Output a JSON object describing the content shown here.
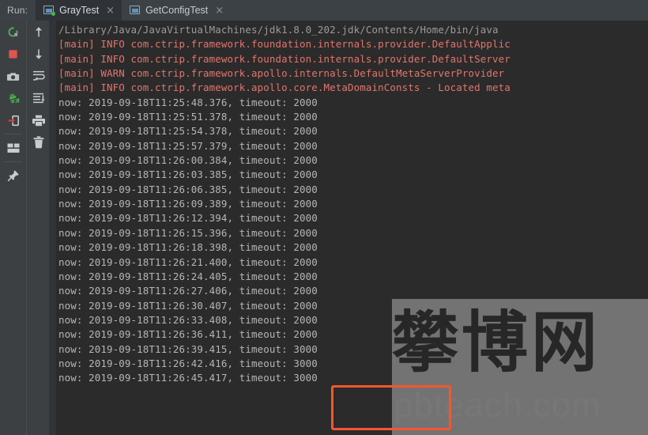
{
  "tabbar": {
    "run_label": "Run:",
    "tabs": [
      {
        "label": "GrayTest",
        "close": "×",
        "active": true,
        "running": true,
        "icon": "run-config-icon"
      },
      {
        "label": "GetConfigTest",
        "close": "×",
        "active": false,
        "running": false,
        "icon": "run-config-icon"
      }
    ]
  },
  "toolbar_left": {
    "items": [
      {
        "name": "rerun-button",
        "icon": "rerun-icon"
      },
      {
        "name": "stop-button",
        "icon": "stop-square-icon"
      },
      {
        "name": "screenshot-button",
        "icon": "camera-icon"
      },
      {
        "name": "rerun-failed-tests-button",
        "icon": "rerun-failed-icon"
      },
      {
        "name": "export-button",
        "icon": "export-arrow-icon"
      },
      {
        "name": "layout-button",
        "icon": "layout-icon"
      },
      {
        "name": "pin-tab-button",
        "icon": "pin-icon"
      }
    ]
  },
  "toolbar_right": {
    "items": [
      {
        "name": "up-stacktrace-button",
        "icon": "arrow-up-icon"
      },
      {
        "name": "down-stacktrace-button",
        "icon": "arrow-down-icon"
      },
      {
        "name": "soft-wrap-button",
        "icon": "soft-wrap-icon"
      },
      {
        "name": "scroll-to-end-button",
        "icon": "scroll-to-end-icon"
      },
      {
        "name": "print-button",
        "icon": "printer-icon"
      },
      {
        "name": "clear-all-button",
        "icon": "trash-icon"
      }
    ]
  },
  "console": {
    "lines": [
      {
        "type": "path",
        "text": "/Library/Java/JavaVirtualMachines/jdk1.8.0_202.jdk/Contents/Home/bin/java"
      },
      {
        "type": "err",
        "text": "[main] INFO com.ctrip.framework.foundation.internals.provider.DefaultApplic"
      },
      {
        "type": "err",
        "text": "[main] INFO com.ctrip.framework.foundation.internals.provider.DefaultServer"
      },
      {
        "type": "err",
        "text": "[main] WARN com.ctrip.framework.apollo.internals.DefaultMetaServerProvider"
      },
      {
        "type": "err",
        "text": "[main] INFO com.ctrip.framework.apollo.core.MetaDomainConsts - Located meta"
      },
      {
        "type": "out",
        "text": "now: 2019-09-18T11:25:48.376, timeout: 2000"
      },
      {
        "type": "out",
        "text": "now: 2019-09-18T11:25:51.378, timeout: 2000"
      },
      {
        "type": "out",
        "text": "now: 2019-09-18T11:25:54.378, timeout: 2000"
      },
      {
        "type": "out",
        "text": "now: 2019-09-18T11:25:57.379, timeout: 2000"
      },
      {
        "type": "out",
        "text": "now: 2019-09-18T11:26:00.384, timeout: 2000"
      },
      {
        "type": "out",
        "text": "now: 2019-09-18T11:26:03.385, timeout: 2000"
      },
      {
        "type": "out",
        "text": "now: 2019-09-18T11:26:06.385, timeout: 2000"
      },
      {
        "type": "out",
        "text": "now: 2019-09-18T11:26:09.389, timeout: 2000"
      },
      {
        "type": "out",
        "text": "now: 2019-09-18T11:26:12.394, timeout: 2000"
      },
      {
        "type": "out",
        "text": "now: 2019-09-18T11:26:15.396, timeout: 2000"
      },
      {
        "type": "out",
        "text": "now: 2019-09-18T11:26:18.398, timeout: 2000"
      },
      {
        "type": "out",
        "text": "now: 2019-09-18T11:26:21.400, timeout: 2000"
      },
      {
        "type": "out",
        "text": "now: 2019-09-18T11:26:24.405, timeout: 2000"
      },
      {
        "type": "out",
        "text": "now: 2019-09-18T11:26:27.406, timeout: 2000"
      },
      {
        "type": "out",
        "text": "now: 2019-09-18T11:26:30.407, timeout: 2000"
      },
      {
        "type": "out",
        "text": "now: 2019-09-18T11:26:33.408, timeout: 2000"
      },
      {
        "type": "out",
        "text": "now: 2019-09-18T11:26:36.411, timeout: 2000"
      },
      {
        "type": "out",
        "text": "now: 2019-09-18T11:26:39.415, timeout: 3000"
      },
      {
        "type": "out",
        "text": "now: 2019-09-18T11:26:42.416, timeout: 3000"
      },
      {
        "type": "out",
        "text": "now: 2019-09-18T11:26:45.417, timeout: 3000"
      }
    ]
  },
  "watermark": {
    "cn": "攀博网",
    "en": "pbteach.com"
  },
  "colors": {
    "console_bg": "#2b2b2b",
    "error_text": "#e2746c",
    "stdout_text": "#b5b5b5",
    "path_text": "#9b9b9b",
    "toolbar_bg": "#3c4043",
    "tabbar_bg": "#3c4145",
    "active_tab_bg": "#2f3337",
    "annotation": "#f4572c",
    "running_dot": "#49b849"
  }
}
